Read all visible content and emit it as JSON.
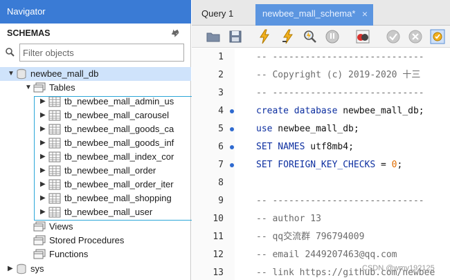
{
  "navigator": {
    "title": "Navigator",
    "schemas_label": "SCHEMAS",
    "filter_placeholder": "Filter objects",
    "tree": {
      "db_name": "newbee_mall_db",
      "tables_label": "Tables",
      "tables": [
        "tb_newbee_mall_admin_us",
        "tb_newbee_mall_carousel",
        "tb_newbee_mall_goods_ca",
        "tb_newbee_mall_goods_inf",
        "tb_newbee_mall_index_cor",
        "tb_newbee_mall_order",
        "tb_newbee_mall_order_iter",
        "tb_newbee_mall_shopping",
        "tb_newbee_mall_user"
      ],
      "views_label": "Views",
      "procedures_label": "Stored Procedures",
      "functions_label": "Functions",
      "sys_label": "sys"
    }
  },
  "editor": {
    "tabs": [
      {
        "label": "Query 1"
      },
      {
        "label": "newbee_mall_schema*"
      }
    ],
    "close_glyph": "×",
    "line_numbers": [
      "1",
      "2",
      "3",
      "4",
      "5",
      "6",
      "7",
      "8",
      "9",
      "10",
      "11",
      "12",
      "13"
    ],
    "lines": {
      "l1": "-- ----------------------------",
      "l2": "-- Copyright (c) 2019-2020 十三",
      "l3": "-- ----------------------------",
      "l4_kw": "create database",
      "l4_rest": " newbee_mall_db;",
      "l5_kw": "use",
      "l5_rest": " newbee_mall_db;",
      "l6_kw": "SET NAMES",
      "l6_rest": " utf8mb4;",
      "l7_kw": "SET FOREIGN_KEY_CHECKS",
      "l7_mid": " = ",
      "l7_num": "0",
      "l7_end": ";",
      "l9": "-- ----------------------------",
      "l10": "-- author 13",
      "l11": "-- qq交流群 796794009",
      "l12": "-- email 2449207463@qq.com",
      "l13": "-- link https://github.com/newbee"
    }
  },
  "watermark": "CSDN @wmy192125",
  "colors": {
    "nav_header": "#3a7bd5",
    "active_tab": "#5b95e0",
    "selection": "#cfe3fb",
    "highlight_box": "#2aa6d8",
    "keyword": "#0d2fa0",
    "number": "#e06c00",
    "comment": "#6b6b6b",
    "marker_dot": "#2f6ad0"
  }
}
